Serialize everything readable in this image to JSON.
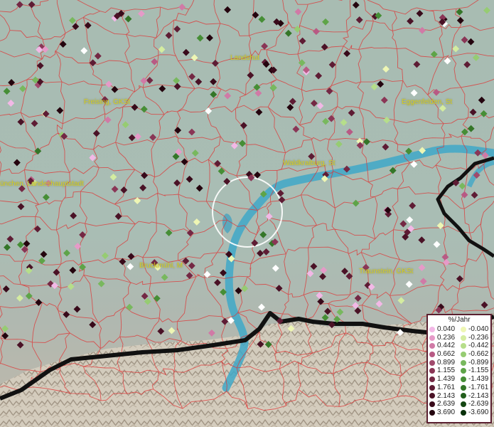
{
  "map": {
    "cities": [
      {
        "id": "landshut",
        "name": "Landshut"
      },
      {
        "id": "freising",
        "name": "Freising, GKSt"
      },
      {
        "id": "eggenfelden",
        "name": "Eggenfelden, St"
      },
      {
        "id": "muenchen",
        "name": "ünchen, Landeshauptstadt"
      },
      {
        "id": "waldkraiburg",
        "name": "Waldkraiburg, St"
      },
      {
        "id": "bruckmuehl",
        "name": "Bruckmühl, M"
      },
      {
        "id": "traunstein",
        "name": "Traunstein, GKSt"
      }
    ]
  },
  "legend": {
    "title": "%/Jahr",
    "positive": [
      {
        "value": "0.040",
        "color": "#f2b8e6"
      },
      {
        "value": "0.236",
        "color": "#e69ac8"
      },
      {
        "value": "0.442",
        "color": "#d07aa6"
      },
      {
        "value": "0.662",
        "color": "#b85a84"
      },
      {
        "value": "0.899",
        "color": "#a04a6c"
      },
      {
        "value": "1.155",
        "color": "#8a3656"
      },
      {
        "value": "1.439",
        "color": "#742844"
      },
      {
        "value": "1.761",
        "color": "#5e1c34"
      },
      {
        "value": "2.143",
        "color": "#4a1226"
      },
      {
        "value": "2.639",
        "color": "#380a1a"
      },
      {
        "value": "3.690",
        "color": "#24040e"
      }
    ],
    "negative": [
      {
        "value": "-0.040",
        "color": "#eef6b4"
      },
      {
        "value": "-0.236",
        "color": "#d4eca0"
      },
      {
        "value": "-0.442",
        "color": "#b6de8a"
      },
      {
        "value": "-0.662",
        "color": "#96cc72"
      },
      {
        "value": "-0.899",
        "color": "#78b85e"
      },
      {
        "value": "-1.155",
        "color": "#5ea448"
      },
      {
        "value": "-1.439",
        "color": "#468e36"
      },
      {
        "value": "-1.761",
        "color": "#347628"
      },
      {
        "value": "-2.143",
        "color": "#225e1c"
      },
      {
        "value": "-2.639",
        "color": "#144612"
      },
      {
        "value": "-3.690",
        "color": "#08300a"
      }
    ]
  }
}
